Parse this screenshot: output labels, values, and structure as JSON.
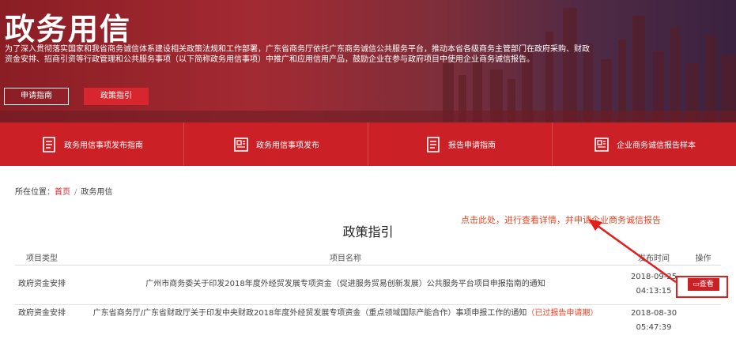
{
  "banner": {
    "title": "政务用信",
    "description": "为了深入贯彻落实国家和我省商务诚信体系建设相关政策法规和工作部署，广东省商务厅依托广东商务诚信公共服务平台，推动本省各级商务主管部门在政府采购、财政资金安排、招商引资等行政管理和公共服务事项（以下简称政务用信事项）中推广和应用信用产品，鼓励企业在参与政府项目中使用企业商务诚信报告。",
    "btn_guide": "申请指南",
    "btn_policy": "政策指引"
  },
  "nav": [
    {
      "label": "政务用信事项发布指南",
      "icon": "document-icon"
    },
    {
      "label": "政务用信事项发布",
      "icon": "news-icon"
    },
    {
      "label": "报告申请指南",
      "icon": "document-icon"
    },
    {
      "label": "企业商务诚信报告样本",
      "icon": "news-icon"
    }
  ],
  "breadcrumb": {
    "prefix": "所在位置：",
    "home": "首页",
    "separator": "/",
    "current": "政务用信"
  },
  "section_title": "政策指引",
  "annotation": "点击此处，进行查看详情，并申请企业商务诚信报告",
  "table": {
    "headers": [
      "项目类型",
      "项目名称",
      "发布时间",
      "操作"
    ],
    "rows": [
      {
        "type": "政府资金安排",
        "name": "广州市商务委关于印发2018年度外经贸发展专项资金（促进服务贸易创新发展）公共服务平台项目申报指南的通知",
        "date": "2018-09-25",
        "time": "04:13:15",
        "action": "查看"
      },
      {
        "type": "政府资金安排",
        "name": "广东省商务厅/广东省财政厅关于印发中央财政2018年度外经贸发展专项资金（重点领域国际产能合作）事项申报工作的通知",
        "status": "（已过报告申请期）",
        "date": "2018-08-30",
        "time": "05:47:39"
      }
    ]
  },
  "colors": {
    "brand_red": "#cc2027",
    "annotation_red": "#e31c1c"
  }
}
